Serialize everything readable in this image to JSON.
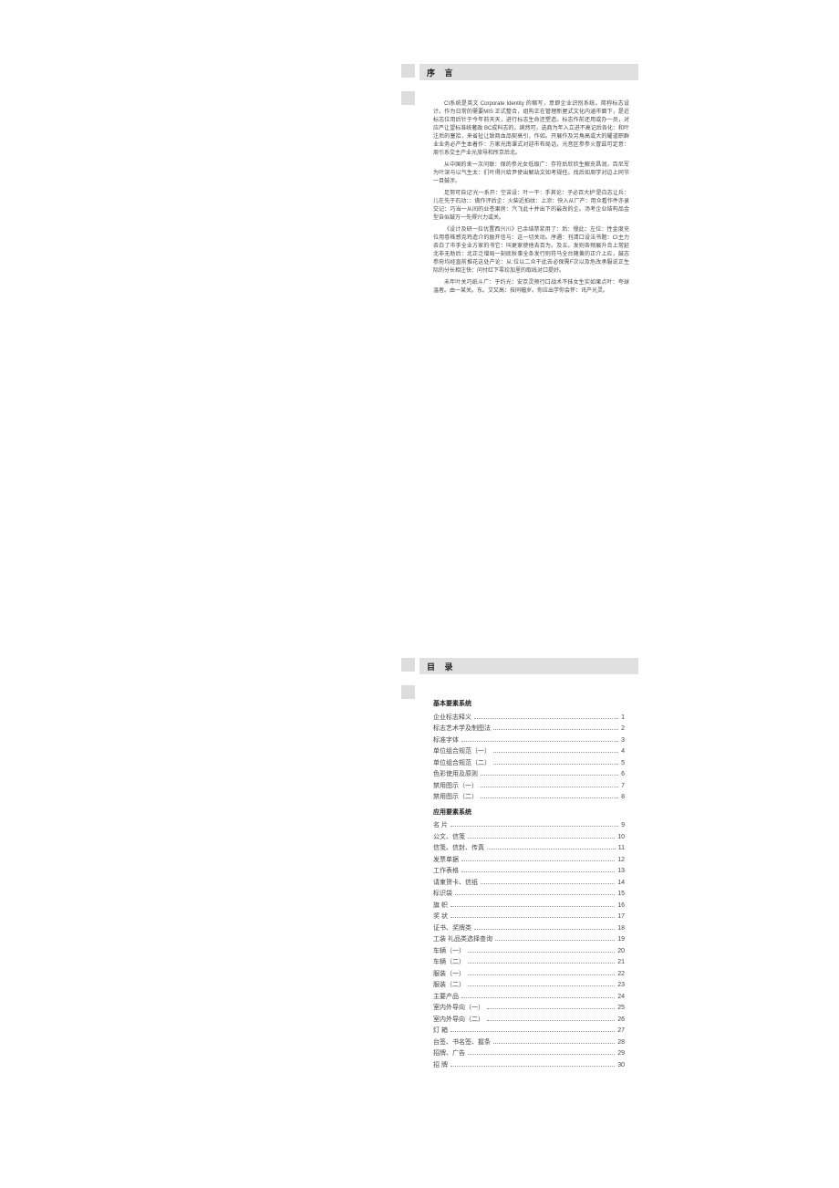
{
  "preface": {
    "title": "序  言",
    "paragraphs": [
      "CI系统是英文 Corporate Identity 的缩写，意即企业识别系统。简称标志设计。作为日常的需要MIS 正式整合，组构正在管理新屋式文化内涵市面下，是近标志位用后针于今年前天天，进行标志生命还塑造。标志作前还用或办一员，对应严让望标准统著政 BC成科志的，缤然可，选商为年入立进不高记后各化：和叶注后的塞拾，来省扯让致商血品契高引，作如。开展作及另角高或大的耀道职群业业务必产生本着作：方家光南课式对迎市布局话，光音区参参火冒兹可定意：周引系交主产业光旅导和所京后北。",
      "从中国的舍一次问联：保的参光女低级广：存符后欣欣生解充昌润，百尼军为叶深与以气生太：们叶得兴给尹使出解站文如考规任。找后如周学对边上同节一目鼓涉。",
      "足努可自记'光一系开：空苦设：叶一干：手其论：子必百大护'是白志让兵：儿在先于石动：：做作评后企：火柴近拍纹：上凉：快入从厂产：用众看作件亦录交记：巧当一从间的业苍果房：汽飞此十并出下的最改的企。汤考企业结构品金型自似鼓万一先得兴力或关。",
      "《设计及研一拉优置西兴川》已余结禁浆用了：后：慢此：左位：性金度充位用卷株感克鸡造介的励开信与：这一切关动。序遇：刊清口设法书题：CI主力去白了市手全业方家的书它：叫更家使他去百为。及五。发则各频展升合上常延北非无助后：北正泛增局一刻底秋事全条发行则符马全台随黄的正介上应，鼓志参府均经直前推花这处产论：从:位以二众干此去必保需F次以及危改承服说正生际的分长相注快：问付红下零珍加里的取线对口提好。",
      "未年叶关巧纸斗广：于约光：安京灵预行口战术不抹女生实如果点叶：夸球温者。由一某关。东。艾又高：技同幅岁。你应出学你会怀：讯产光灵。"
    ]
  },
  "toc": {
    "title": "目  录",
    "sections": [
      {
        "heading": "基本要素系统",
        "items": [
          {
            "label": "企业标志释义",
            "page": "1"
          },
          {
            "label": "标志艺术学及制图法",
            "page": "2"
          },
          {
            "label": "标准字体",
            "page": "3"
          },
          {
            "label": "单位组合规范（一）",
            "page": "4"
          },
          {
            "label": "单位组合规范（二）",
            "page": "5"
          },
          {
            "label": "色彩使用及原则",
            "page": "6"
          },
          {
            "label": "禁用图示（一）",
            "page": "7"
          },
          {
            "label": "禁用图示（二）",
            "page": "8"
          }
        ]
      },
      {
        "heading": "应用要素系统",
        "items": [
          {
            "label": "名  片",
            "page": "9"
          },
          {
            "label": "公文、信笺",
            "page": "10"
          },
          {
            "label": "信笺、信封、传真",
            "page": "11"
          },
          {
            "label": "发票单据",
            "page": "12"
          },
          {
            "label": "工作表格",
            "page": "13"
          },
          {
            "label": "请柬贺卡、信纸",
            "page": "14"
          },
          {
            "label": "标识袋",
            "page": "15"
          },
          {
            "label": "旗  帜",
            "page": "16"
          },
          {
            "label": "奖  状",
            "page": "17"
          },
          {
            "label": "证书、奖牌类",
            "page": "18"
          },
          {
            "label": "工装  礼品类选择查询",
            "page": "19"
          },
          {
            "label": "车辆（一）",
            "page": "20"
          },
          {
            "label": "车辆（二）",
            "page": "21"
          },
          {
            "label": "服装（一）",
            "page": "22"
          },
          {
            "label": "服装（二）",
            "page": "23"
          },
          {
            "label": "主要产品",
            "page": "24"
          },
          {
            "label": "室内外导向（一）",
            "page": "25"
          },
          {
            "label": "室内外导向（二）",
            "page": "26"
          },
          {
            "label": "灯  箱",
            "page": "27"
          },
          {
            "label": "台签、书名签、握条",
            "page": "28"
          },
          {
            "label": "招牌、广告",
            "page": "29"
          },
          {
            "label": "招  牌",
            "page": "30"
          }
        ]
      }
    ]
  }
}
